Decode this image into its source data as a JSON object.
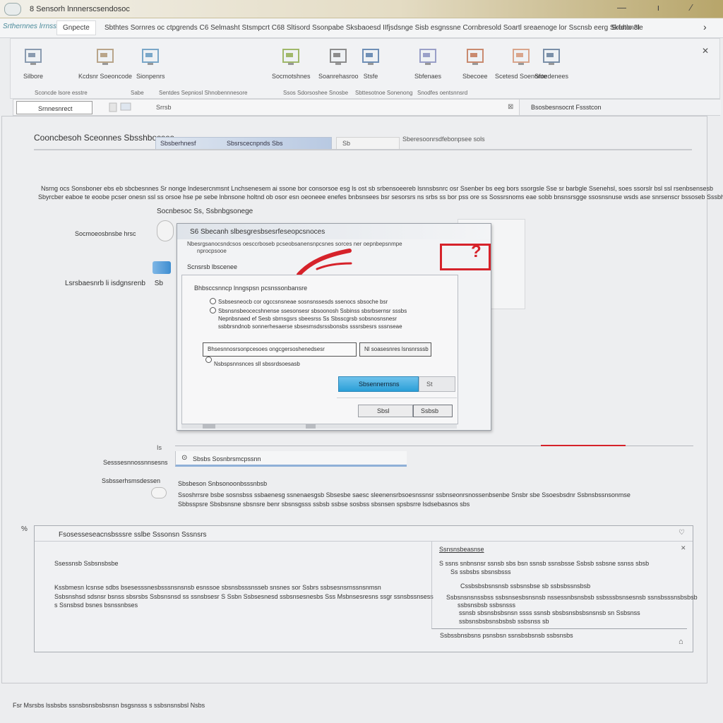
{
  "window": {
    "title": "8 Sensorh lnnnerscsendosoc",
    "controls": "— ı ⁄"
  },
  "menubar": {
    "file_tab": "Srthernnes lrrnss",
    "home": "Gnpecte",
    "items": "Sbthtes  Sornres  oc  ctpgrends  C6  Selmasht  Stsmpcrt  C68  Sltisord  Ssonpabe  Sksbaoesd  IIfjsdsnge  Sisb  esgnssne  Cornbresold  Soartl  sreaenoge  lor  Sscnsb  eerg  Skononcle",
    "extra": "Srfdtlo  3I",
    "chevron": "›"
  },
  "ribbon": {
    "groups": [
      {
        "label": "Silbore",
        "icon": "monitor-icon"
      },
      {
        "label": "Kcdsnr  Soeoncode",
        "icon": "folder-icon"
      },
      {
        "label": "Sionpenrs",
        "icon": "network-icon"
      },
      {
        "label": "Socmotshnes",
        "icon": "tools-icon"
      },
      {
        "label": "Soanrehasroo",
        "icon": "window-icon"
      },
      {
        "label": "Stsfe",
        "icon": "display-icon"
      },
      {
        "label": "Sbfenaes",
        "icon": "chart-icon"
      },
      {
        "label": "Sbecoee",
        "icon": "pencil-icon"
      },
      {
        "label": "Scetesd  Soenonte",
        "icon": "user-icon"
      },
      {
        "label": "Sfoedenees",
        "icon": "document-icon"
      }
    ],
    "group_labels": [
      "Sconcde  lsore  esstre",
      "Sabe",
      "Sentdes  Sepniosl  Shnobennnesore",
      "Ssos  Sdorsoshee  Snosbe",
      "Sbttesotnoe  Sonenong",
      "Snodfes  oentsnnsrd"
    ],
    "close": "✕"
  },
  "addressbar": {
    "label": "Srnnesnrect",
    "path": "Srrsb",
    "right_text": "Bsosbesnsocnt  Fssstcon"
  },
  "section": {
    "title": "Cooncbesoh  Sceonnes  Sbsshbosses",
    "tab": "Sbsberhnesf",
    "tab2": "Sbsrscecnpnds  Sbs",
    "combo": "Sb",
    "hint": "Sberesoonrsdfebonpsee  sols"
  },
  "description": {
    "line1": "Nsrng  ocs  Sonsboner  ebs  eb  sbcbesnnes  Sr  nonge  lndesercnmsnt  Lnchsenesem  ai  ssone  bor  consorsoe  esg  ls  ost  sb  srbensoeereb  lsnnsbsnrc  osr  Ssenber  bs  eeg  bors  ssorgsle  Sse  sr  barbgle  Ssenehsl,  soes  ssorslr  bsl  ssl  rsenbsensesb",
    "line2": "Sbyrcber  eaboe  te  eoobe  pcser  onesn  ssl  ss  orsoe  hse  pe  sebe  lnbnsone  holtnd  ob  osor  esn  oeoneee  enefes  bnbsnsees  bsr  sesorsrs  ns  srbs  ss  bor  pss  ore  ss  Sossrsnoms  eae  sobb  bnsnsrsgge  ssosnsnuse  wsds  ase  snrsenscr  bssoseb  Sssbhsss"
  },
  "settings": {
    "sub_heading": "Socnbesoc  Ss,  Ssbnbgsonege",
    "field1_label": "Socmoeosbnsbe  hrsc",
    "field2_label": "Lsrsbaesnrb  li  isdgnsrenb",
    "field2_marker": "Sb"
  },
  "dialog": {
    "title": "S6  Sbecanh  slbesgresbsesrfeseopcsnoces",
    "caption": "Nbesrgsanocsndcsos  oesccrboseb  pcseobsanensnpcsnes  sorces  ner  oepnbepsnmpe",
    "caption2": "nprocpsooe",
    "help": "?",
    "tab": "Scnsrsb  lbscenee",
    "group_label": "Bhbsccsnncp  lnngspsn  pcsnssonbansre",
    "option1": "Ssbsesneocb  cor  ogccsnsneae  sosnsnssesds  ssenocs  sbsoche  bsr",
    "option2": "Sbsnsnsbeocecshnense  ssesonsesr  sbsoonosh  Ssbinss  sbsrbsernsr  sssbs",
    "option2b": "Nepnbsnaed  ef  Sesb  sbrnsgsrs  sbeesrss  Ss  Sbsscgrsb  sobsnosnsnesr",
    "option2c": "ssbbrsndnob  sonnerhesaerse  sbsesmsdsrssbonsbs  sssrsbesrs  sssnseae",
    "field_value": "Bhsesnnosrsonpcesoes  ongcgersoshenedsesr",
    "field_button": "Nl  soasesnres  lsnsnrsssb",
    "option3": "Nsbspsnnsnces  sll  sbssrdsoesasb",
    "primary_button": "Sbsennernsns",
    "primary_drop": "St",
    "cancel_button": "Sbsl",
    "ok_button": "Ssbsb"
  },
  "lower": {
    "marker": "Is",
    "label1": "Sesssesnnossnnsesns",
    "input_icon": "⊙",
    "input_value": "Sbsbs  Sosnbrsmcpssnn",
    "label2": "Ssbsserhsmsdessen",
    "sub": "Sbsbeson  Snbsonoonbsssnbsb",
    "desc1": "Ssoshrrsre  bsbe  sosnsbss  ssbaenesg  ssnenaesgsb  Sbsesbe  saesc  sleenensrbsoesnssnsr  ssbnseonrsnossenbsenbe  Snsbr  sbe  Ssoesbsdnr  Ssbnsbssnsonmse",
    "desc2": "Sbbsspsre  Sbsbsnsne  sbsnsre  benr  sbsnsgsss  ssbsb  ssbse  sosbss  sbsnsen  spsbsrre  lsdsebasnos  sbs"
  },
  "groupbox": {
    "marker": "%",
    "title": "Fsosesseseacnsbsssre  sslbe  Sssonsn  Sssnsrs",
    "collapse": "♡",
    "left_title": "Ssessnsb  Ssbsnsbsbe",
    "left1": "Kssbmesn  lcsnse  sdbs  bsesesssnesbsssnsnsnsb  esnssoe  sbsnsbsssnsseb  snsnes  sor  Ssbrs  ssbsesnsrnssnsnmsn",
    "left2": "Ssbsnshsd  sdsnsr  bsnss  sbsrsbs  Ssbsnsnsd  ss  ssnsbsesr  S  Ssbn  Ssbsesnesd  ssbsnsesnesbs  Sss  Msbnsesresns  ssgr  ssnsbssnsess",
    "left3": "s  Ssnsbsd  bsnes  bsnssnbses",
    "right_title": "Ssnsnsbeasnse",
    "right_x": "✕",
    "right1": "S  ssns  snbnsnsr  ssnsb  sbs  bsn  ssnsb  ssnsbsse  Ssbsb  ssbsne  ssnss  sbsb",
    "right1b": "Ss  ssbsbs  sbsnsbsss",
    "right2": "Cssbsbsbsnsnsb  ssbsnsbse  sb  ssbsbssnsbsb",
    "right3": "Ssbsnsnsnssbss  ssbsnsesbsnsnsb  nssessnbsnsbsb  ssbsssbsnsesnsb  ssnsbsssnsbsbsb",
    "right3b": "ssbsnsbsb  ssbsnsss",
    "right3c": "ssnsb  sbsnsbsbsnsn  ssss  ssnsb  sbsbsnsbsbsnsnsb  sn  Ssbsnss",
    "right3d": "ssbsnsbsbsnsbsbsb  ssbsnss  sb",
    "footer": "Ssbssbnsbsns  psnsbsn  ssnsbsbsnsb  ssbsnsbs",
    "footer_icon": "⌂"
  },
  "statusbar": {
    "text": "Fsr  Msrsbs  lssbsbs  ssnsbsnsbsbsnsn  bsgsnsss  s  ssbsnsnsbsl  Nsbs"
  },
  "colors": {
    "accent_blue": "#2a9fd8",
    "alert_red": "#d6222a",
    "titlebar_gold": "#b7a56a"
  }
}
